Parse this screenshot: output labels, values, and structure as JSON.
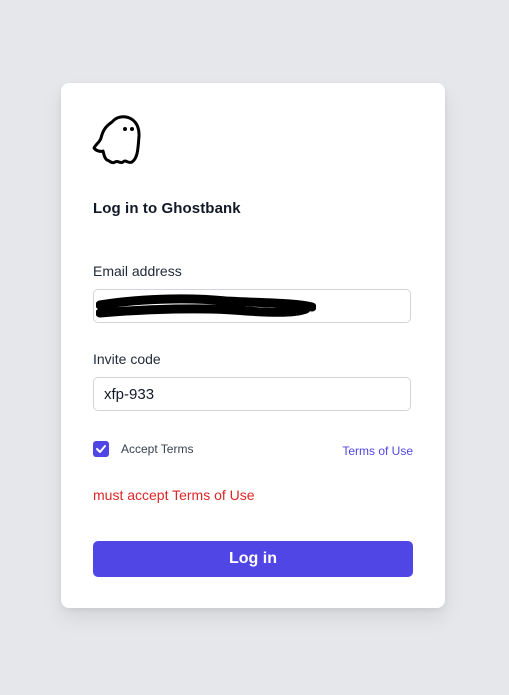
{
  "brand": {
    "logo_icon": "ghost-icon"
  },
  "form": {
    "title": "Log in to Ghostbank",
    "email_label": "Email address",
    "email_value": "",
    "invite_label": "Invite code",
    "invite_value": "xfp-933",
    "accept_terms_label": "Accept Terms",
    "accept_terms_checked": true,
    "terms_link_label": "Terms of Use",
    "error_message": "must accept Terms of Use",
    "submit_label": "Log in"
  },
  "colors": {
    "background": "#e5e7eb",
    "accent": "#4f46e5",
    "error": "#dc2626"
  }
}
